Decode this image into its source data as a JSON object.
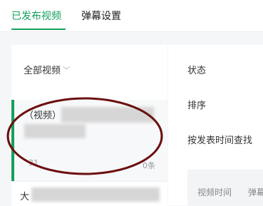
{
  "tabs": [
    {
      "label": "已发布视频",
      "active": true
    },
    {
      "label": "弹幕设置",
      "active": false
    }
  ],
  "accent_color": "#13a05c",
  "left": {
    "filter_label": "全部视频",
    "filter_icon": "chevron-down-icon",
    "items": [
      {
        "title": "（视频）",
        "count": "31",
        "danmu": "0条"
      },
      {
        "title": "大"
      }
    ]
  },
  "right": {
    "status_label": "状态",
    "sort_label": "排序",
    "search_label": "按发表时间查找",
    "table_headers": [
      "视频时间",
      "弹幕"
    ]
  },
  "annotation_color": "#6b0f0f"
}
